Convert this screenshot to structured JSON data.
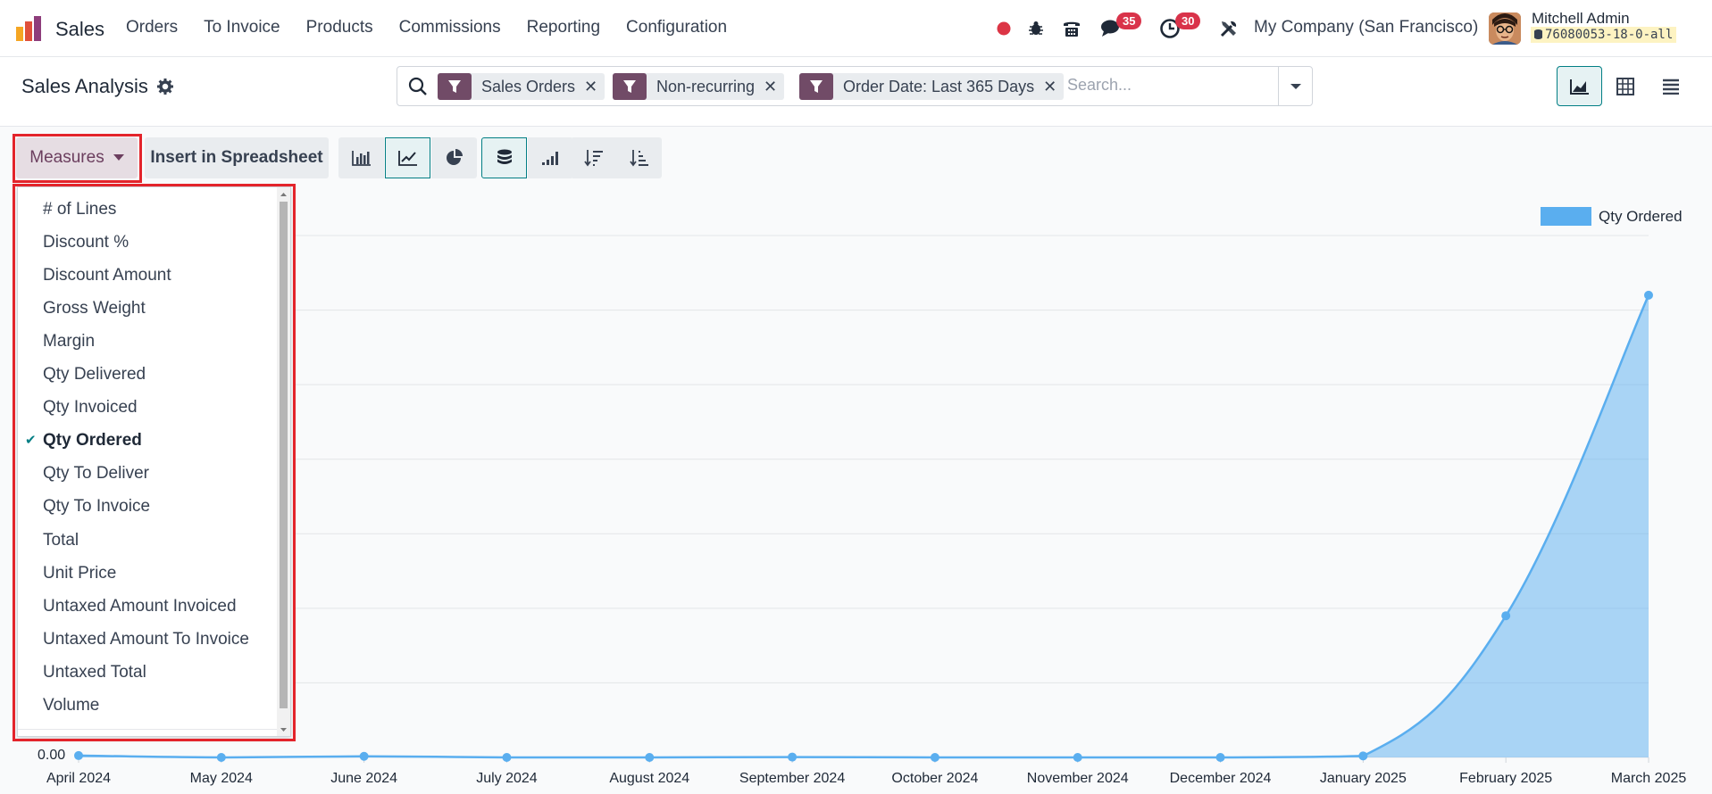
{
  "navbar": {
    "app_name": "Sales",
    "menu": [
      "Orders",
      "To Invoice",
      "Products",
      "Commissions",
      "Reporting",
      "Configuration"
    ],
    "messages_count": "35",
    "activities_count": "30",
    "company": "My Company (San Francisco)",
    "user_name": "Mitchell Admin",
    "db_name": "76080053-18-0-all"
  },
  "control_panel": {
    "title": "Sales Analysis",
    "facets": [
      {
        "label": "Sales Orders"
      },
      {
        "label": "Non-recurring"
      },
      {
        "label": "Order Date: Last 365 Days"
      }
    ],
    "search_placeholder": "Search..."
  },
  "toolbar": {
    "measures_label": "Measures",
    "insert_label": "Insert in Spreadsheet"
  },
  "measures_menu": {
    "items": [
      "# of Lines",
      "Discount %",
      "Discount Amount",
      "Gross Weight",
      "Margin",
      "Qty Delivered",
      "Qty Invoiced",
      "Qty Ordered",
      "Qty To Deliver",
      "Qty To Invoice",
      "Total",
      "Unit Price",
      "Untaxed Amount Invoiced",
      "Untaxed Amount To Invoice",
      "Untaxed Total",
      "Volume"
    ],
    "selected": "Qty Ordered"
  },
  "chart_data": {
    "type": "area",
    "x": [
      "April 2024",
      "May 2024",
      "June 2024",
      "July 2024",
      "August 2024",
      "September 2024",
      "October 2024",
      "November 2024",
      "December 2024",
      "January 2025",
      "February 2025",
      "March 2025"
    ],
    "series": [
      {
        "name": "Qty Ordered",
        "values": [
          0.5,
          0,
          0.3,
          0,
          0,
          0.1,
          0,
          0,
          0,
          0.4,
          38,
          124
        ]
      }
    ],
    "y_tick_labels": [
      "0.00"
    ],
    "ylim": [
      0,
      140
    ],
    "grid": true,
    "legend_position": "top-right",
    "color": "#5aaeef"
  },
  "colors": {
    "brand": "#714b67",
    "accent": "#017e84",
    "highlight": "#e3242b"
  }
}
